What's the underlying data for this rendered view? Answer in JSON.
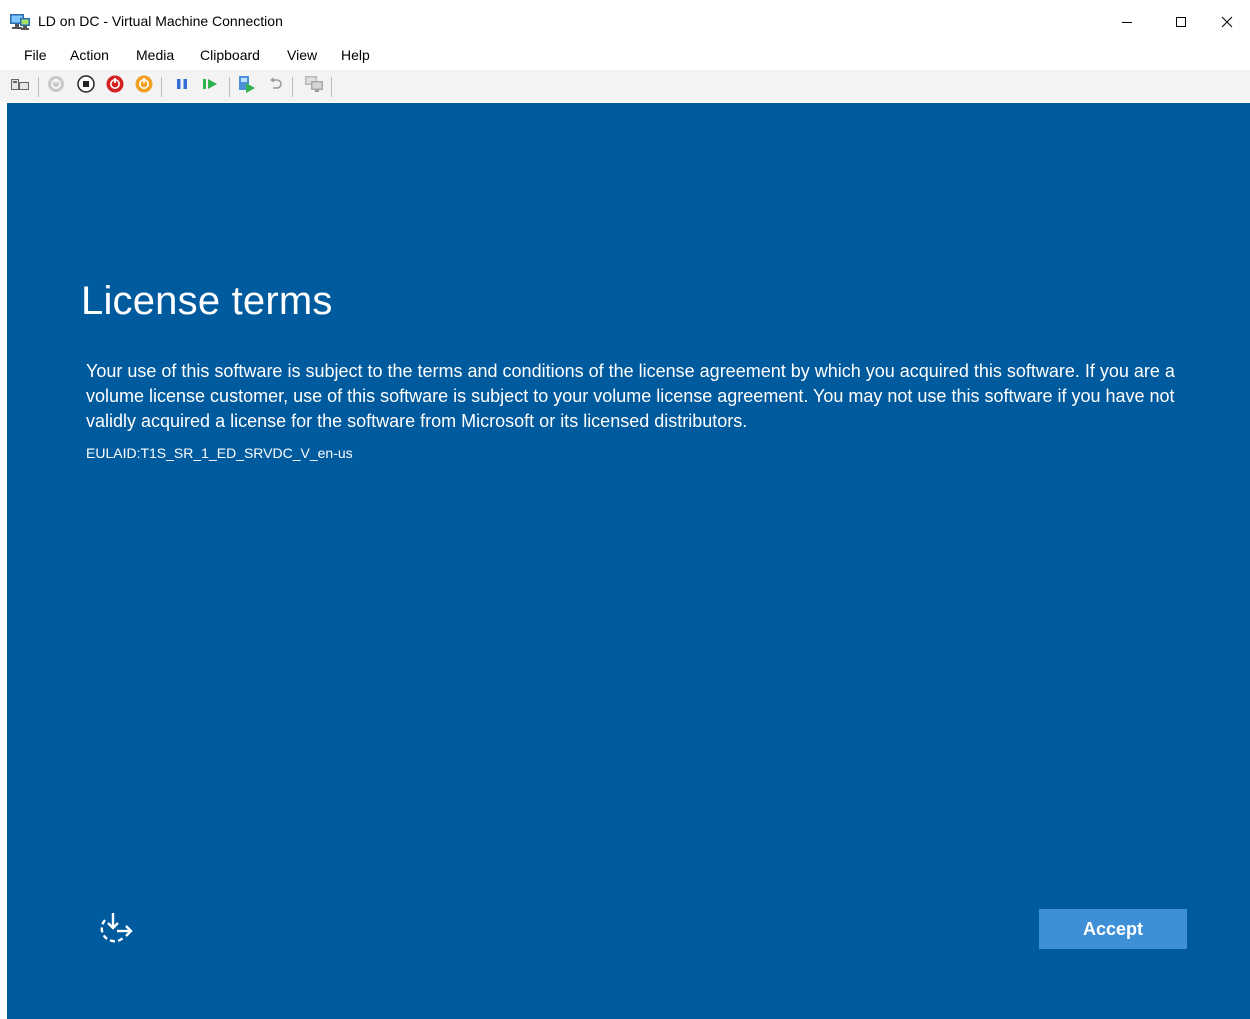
{
  "window": {
    "title": "LD on DC - Virtual Machine Connection",
    "app_icon": "vm-connection-icon",
    "controls": {
      "minimize": "minimize-icon",
      "maximize": "maximize-icon",
      "close": "close-icon"
    }
  },
  "menubar": {
    "items": [
      "File",
      "Action",
      "Media",
      "Clipboard",
      "View",
      "Help"
    ]
  },
  "toolbar": {
    "buttons": [
      "ctrl-alt-del-icon",
      "start-icon",
      "turn-off-icon",
      "shut-down-icon",
      "save-icon",
      "pause-icon",
      "resume-icon",
      "checkpoint-icon",
      "revert-icon",
      "enhanced-session-icon"
    ],
    "colors": {
      "shut_down": "#d32020",
      "save": "#f0a020",
      "pause": "#2f6fd6",
      "resume": "#2fb34a"
    }
  },
  "screen": {
    "background": "#005a9e",
    "heading": "License terms",
    "body": "Your use of this software is subject to the terms and conditions of the license agreement by which you acquired this software.  If you are a volume license customer, use of this software is subject to your volume license agreement.  You may not use this software if you have not validly acquired a license for the software from Microsoft or its licensed distributors.",
    "eula_id": "EULAID:T1S_SR_1_ED_SRVDC_V_en-us",
    "ease_of_access_icon": "ease-of-access-icon",
    "accept_label": "Accept",
    "accept_color": "#3f8fd6"
  }
}
